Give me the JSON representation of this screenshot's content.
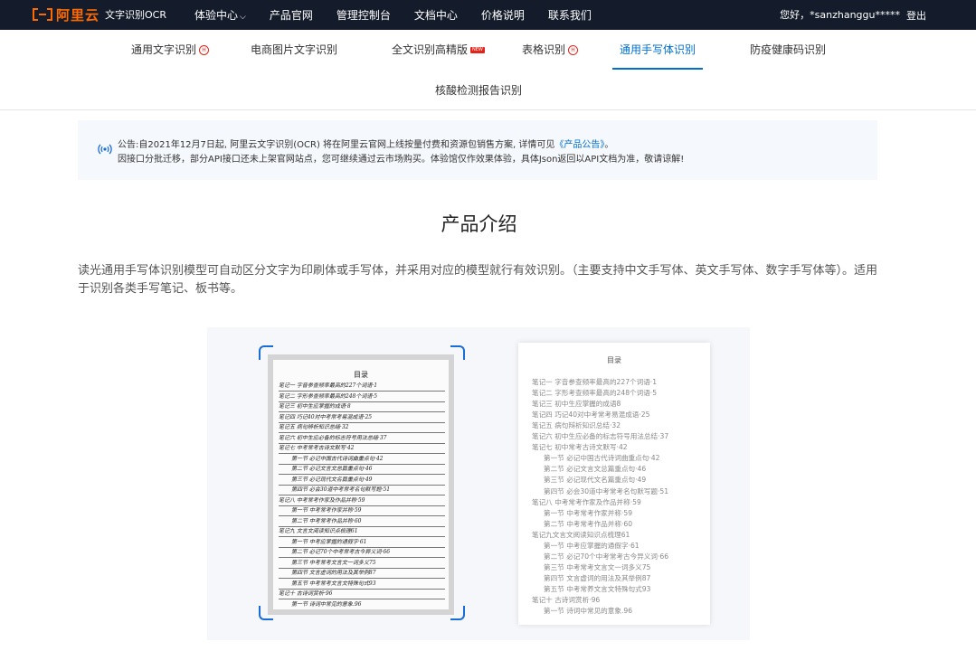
{
  "header": {
    "logo_text": "阿里云",
    "product_name": "文字识别OCR",
    "nav": [
      {
        "label": "体验中心",
        "has_dropdown": true
      },
      {
        "label": "产品官网",
        "has_dropdown": false
      },
      {
        "label": "管理控制台",
        "has_dropdown": false
      },
      {
        "label": "文档中心",
        "has_dropdown": false
      },
      {
        "label": "价格说明",
        "has_dropdown": false
      },
      {
        "label": "联系我们",
        "has_dropdown": false
      }
    ],
    "greeting": "您好，*sanzhanggu*****",
    "logout": "登出",
    "brand_color": "#ff6a00"
  },
  "tabs": [
    {
      "label": "通用文字识别",
      "marker": "hot",
      "active": false
    },
    {
      "label": "电商图片文字识别",
      "marker": "",
      "active": false
    },
    {
      "label": "全文识别高精版",
      "marker": "new",
      "active": false
    },
    {
      "label": "表格识别",
      "marker": "hot",
      "active": false
    },
    {
      "label": "通用手写体识别",
      "marker": "",
      "active": true
    },
    {
      "label": "防疫健康码识别",
      "marker": "",
      "active": false
    },
    {
      "label": "核酸检测报告识别",
      "marker": "",
      "active": false
    }
  ],
  "notice": {
    "icon": "broadcast-icon",
    "line1_prefix": "公告:自2021年12月7日起, 阿里云文字识别(OCR) 将在阿里云官网上线按量付费和资源包销售方案, 详情可见",
    "line1_link": "《产品公告》",
    "line1_suffix": "。",
    "line2": "因接口分批迁移，部分API接口还未上架官网站点，您可继续通过云市场购买。体验馆仅作效果体验，具体Json返回以API文档为准，敬请谅解!"
  },
  "intro": {
    "title": "产品介绍",
    "description": "读光通用手写体识别模型可自动区分文字为印刷体或手写体，并采用对应的模型就行有效识别。（主要支持中文手写体、英文手写体、数字手写体等）。适用于识别各类手写笔记、板书等。"
  },
  "demo": {
    "handwritten_title": "目录",
    "handwritten_lines": [
      "笔记一  字音参查频率最高的227个词语·1",
      "笔记二  字形参查频率最高的248个词语·5",
      "笔记三  初中生应掌握的成语·8",
      "笔记四  巧记40对中考常考易混成语·25",
      "笔记五  病句辨析知识总结·32",
      "笔记六  初中生应必备的标志符号用法总结·37",
      "笔记七  中考常考古诗文默写·42",
      "第一节  必记中国古代诗词曲重点句·42",
      "第二节  必记文言文总篇重点句·46",
      "第三节  必记现代文名篇重点句·49",
      "第四节  必会30道中考常考名句默写题·51",
      "笔记八  中考常考作家及作品并称·59",
      "第一节  中考常考作家并称·59",
      "第二节  中考常考作品并称·60",
      "笔记九  文言文阅读知识点梳理61",
      "第一节  中考应掌握的通假字·61",
      "第二节  必记70个中考常考古今异义词·66",
      "第三节  中考常考文言文一词多义75",
      "第四节  文言虚词的用法及其举例87",
      "第五节  中考常考文言文特殊句式93",
      "笔记十  古诗词赏析·96",
      "第一节  诗词中常见的意象.96"
    ],
    "result_title": "目录",
    "result_lines": [
      {
        "text": "笔记一 字音参查频率最高的227个词语·1",
        "sub": false
      },
      {
        "text": "笔记二 字形考查频率最高的248个词语·5",
        "sub": false
      },
      {
        "text": "笔记三 初中生应掌握的成语8",
        "sub": false
      },
      {
        "text": "笔记四 巧记40对中考常考易混成语·25",
        "sub": false
      },
      {
        "text": "笔记五 病句辩析知识总结·32",
        "sub": false
      },
      {
        "text": "笔记六 初中生应必备的标志符号用法总结·37",
        "sub": false
      },
      {
        "text": "笔记七 初中常考古诗文默写·42",
        "sub": false
      },
      {
        "text": "第一节 必记中国古代诗词曲重点句·42",
        "sub": true
      },
      {
        "text": "第二节 必记文言文总篇重点句·46",
        "sub": true
      },
      {
        "text": "第三节 必记现代文名篇重点句·49",
        "sub": true
      },
      {
        "text": "第四节 必会30道中考常考名句默写题·51",
        "sub": true
      },
      {
        "text": "笔记八 中考常考作家及作品并称·59",
        "sub": false
      },
      {
        "text": "第一节 中考常考作家并称·59",
        "sub": true
      },
      {
        "text": "第二节 中考常考作品并称·60",
        "sub": true
      },
      {
        "text": "笔记九文言文阅读知识点梳理61",
        "sub": false
      },
      {
        "text": "第一节 中考应掌握的通假字·61",
        "sub": true
      },
      {
        "text": "第二节 必记70个中考常考古今异义词·66",
        "sub": true
      },
      {
        "text": "第三节 中考常考文言文一词多义75",
        "sub": true
      },
      {
        "text": "第四节 文言虚词的用法及其举例87",
        "sub": true
      },
      {
        "text": "第五节 中考常养文言文特殊句式93",
        "sub": true
      },
      {
        "text": "笔记十 古诗词赏析·96",
        "sub": false
      },
      {
        "text": "第一节 诗词中常见的意象.96",
        "sub": true
      }
    ]
  },
  "colors": {
    "accent": "#0070cc",
    "hot_marker": "#e1251b",
    "header_bg": "#141c2b",
    "notice_bg": "#f5f8fc"
  }
}
